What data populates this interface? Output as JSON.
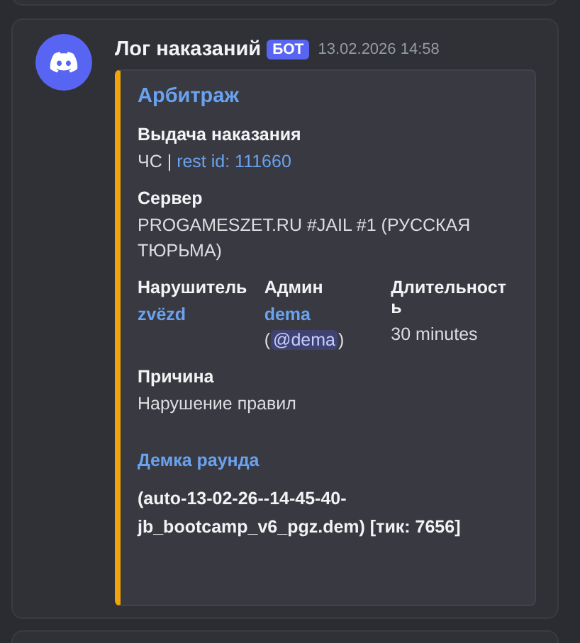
{
  "message": {
    "author": "Лог наказаний",
    "badge": "БОТ",
    "timestamp": "13.02.2026 14:58",
    "embed": {
      "color": "#f0a30a",
      "title": "Арбитраж",
      "fields": [
        {
          "kind": "block",
          "name": "Выдача наказания",
          "parts": [
            {
              "kind": "plain",
              "text": "ЧС | "
            },
            {
              "kind": "link",
              "text": "rest id: 111660"
            }
          ]
        },
        {
          "kind": "block",
          "name": "Сервер",
          "parts": [
            {
              "kind": "plain",
              "text": "PROGAMESZET.RU #JAIL #1 (РУССКАЯ ТЮРЬМА)"
            }
          ]
        },
        {
          "kind": "inline",
          "columns": [
            {
              "name": "Нарушитель",
              "parts": [
                {
                  "kind": "user",
                  "text": "zvëzd"
                }
              ]
            },
            {
              "name": "Админ",
              "parts": [
                {
                  "kind": "user",
                  "text": "dema"
                },
                {
                  "kind": "plain",
                  "text": "("
                },
                {
                  "kind": "mention",
                  "text": "@dema"
                },
                {
                  "kind": "plain",
                  "text": ")"
                }
              ]
            },
            {
              "name": "Длительность",
              "parts": [
                {
                  "kind": "plain",
                  "text": "30 minutes"
                }
              ]
            }
          ]
        },
        {
          "kind": "block",
          "name": "Причина",
          "parts": [
            {
              "kind": "plain",
              "text": "Нарушение правил"
            }
          ]
        },
        {
          "kind": "heading",
          "name": "Демка раунда"
        },
        {
          "kind": "bold",
          "text": "(auto-13-02-26--14-45-40-jb_bootcamp_v6_pgz.dem) [тик: 7656]"
        }
      ]
    }
  }
}
